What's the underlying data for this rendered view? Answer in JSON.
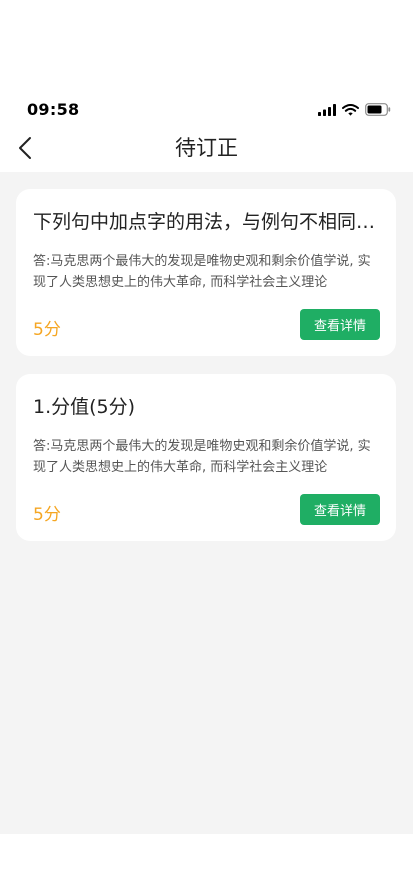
{
  "status_bar": {
    "time": "09:58",
    "icons": [
      "signal-icon",
      "wifi-icon",
      "battery-icon"
    ]
  },
  "nav": {
    "title": "待订正",
    "back_icon": "chevron-left-icon"
  },
  "colors": {
    "accent_green": "#1fae64",
    "score_orange": "#f5a623",
    "page_background": "#f4f4f4"
  },
  "cards": [
    {
      "title": "下列句中加点字的用法，与例句不相同的一项是",
      "answer": "答:马克思两个最伟大的发现是唯物史观和剩余价值学说, 实现了人类思想史上的伟大革命, 而科学社会主义理论",
      "score": "5分",
      "button_label": "查看详情"
    },
    {
      "title": "1.分值(5分)",
      "answer": "答:马克思两个最伟大的发现是唯物史观和剩余价值学说, 实现了人类思想史上的伟大革命, 而科学社会主义理论",
      "score": "5分",
      "button_label": "查看详情"
    }
  ]
}
